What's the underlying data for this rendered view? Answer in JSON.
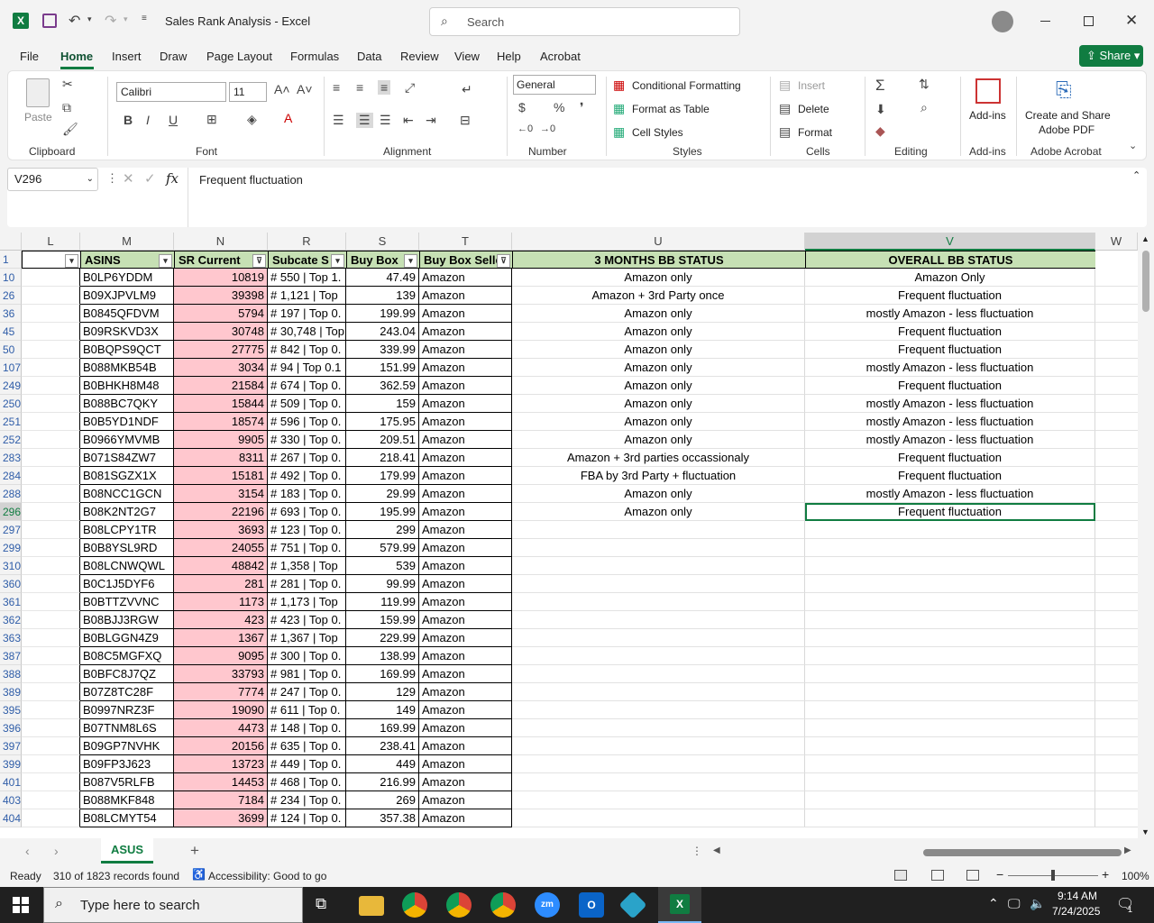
{
  "titlebar": {
    "doc_title": "Sales Rank Analysis",
    "app": "Excel",
    "separator": "-",
    "search_placeholder": "Search"
  },
  "menu": {
    "tabs": [
      "File",
      "Home",
      "Insert",
      "Draw",
      "Page Layout",
      "Formulas",
      "Data",
      "Review",
      "View",
      "Help",
      "Acrobat"
    ],
    "share": "Share"
  },
  "ribbon": {
    "clipboard": {
      "paste": "Paste",
      "label": "Clipboard"
    },
    "font": {
      "name": "Calibri",
      "size": "11",
      "label": "Font"
    },
    "alignment": {
      "label": "Alignment"
    },
    "number": {
      "format": "General",
      "label": "Number",
      "currency": "$",
      "percent": "%"
    },
    "styles": {
      "conditional": "Conditional Formatting",
      "format_table": "Format as Table",
      "cell_styles": "Cell Styles",
      "label": "Styles"
    },
    "cells": {
      "insert": "Insert",
      "delete": "Delete",
      "format": "Format",
      "label": "Cells"
    },
    "editing": {
      "label": "Editing"
    },
    "addins": {
      "btn": "Add-ins",
      "label": "Add-ins"
    },
    "acrobat": {
      "btn1": "Create and Share",
      "btn2": "Adobe PDF",
      "label": "Adobe Acrobat"
    }
  },
  "formula_bar": {
    "name_box": "V296",
    "fx": "fx",
    "value": "Frequent fluctuation"
  },
  "columns": [
    "L",
    "M",
    "N",
    "R",
    "S",
    "T",
    "U",
    "V",
    "W"
  ],
  "headers": {
    "row": "1",
    "M": "ASINS",
    "N": "SR Current",
    "R": "Subcate S",
    "S": "Buy Box",
    "T": "Buy Box Selle",
    "U": "3 MONTHS BB STATUS",
    "V": "OVERALL BB STATUS"
  },
  "rows": [
    {
      "n": "10",
      "m": "B0LP6YDDM",
      "sr": "10819",
      "sub": "# 550 | Top 1.",
      "bb": "47.49",
      "t": "Amazon",
      "u": "Amazon only",
      "v": "Amazon Only"
    },
    {
      "n": "26",
      "m": "B09XJPVLM9",
      "sr": "39398",
      "sub": "# 1,121 | Top",
      "bb": "139",
      "t": "Amazon",
      "u": "Amazon + 3rd Party once",
      "v": "Frequent fluctuation"
    },
    {
      "n": "36",
      "m": "B0845QFDVM",
      "sr": "5794",
      "sub": "# 197 | Top 0.",
      "bb": "199.99",
      "t": "Amazon",
      "u": "Amazon only",
      "v": "mostly Amazon - less fluctuation"
    },
    {
      "n": "45",
      "m": "B09RSKVD3X",
      "sr": "30748",
      "sub": "# 30,748 | Top",
      "bb": "243.04",
      "t": "Amazon",
      "u": "Amazon only",
      "v": "Frequent fluctuation"
    },
    {
      "n": "50",
      "m": "B0BQPS9QCT",
      "sr": "27775",
      "sub": "# 842 | Top 0.",
      "bb": "339.99",
      "t": "Amazon",
      "u": "Amazon only",
      "v": "Frequent fluctuation"
    },
    {
      "n": "107",
      "m": "B088MKB54B",
      "sr": "3034",
      "sub": "# 94 | Top 0.1",
      "bb": "151.99",
      "t": "Amazon",
      "u": "Amazon only",
      "v": "mostly Amazon - less fluctuation"
    },
    {
      "n": "249",
      "m": "B0BHKH8M48",
      "sr": "21584",
      "sub": "# 674 | Top 0.",
      "bb": "362.59",
      "t": "Amazon",
      "u": "Amazon only",
      "v": "Frequent fluctuation"
    },
    {
      "n": "250",
      "m": "B088BC7QKY",
      "sr": "15844",
      "sub": "# 509 | Top 0.",
      "bb": "159",
      "t": "Amazon",
      "u": "Amazon only",
      "v": "mostly Amazon - less fluctuation"
    },
    {
      "n": "251",
      "m": "B0B5YD1NDF",
      "sr": "18574",
      "sub": "# 596 | Top 0.",
      "bb": "175.95",
      "t": "Amazon",
      "u": "Amazon only",
      "v": "mostly Amazon - less fluctuation"
    },
    {
      "n": "252",
      "m": "B0966YMVMB",
      "sr": "9905",
      "sub": "# 330 | Top 0.",
      "bb": "209.51",
      "t": "Amazon",
      "u": "Amazon only",
      "v": "mostly Amazon - less fluctuation"
    },
    {
      "n": "283",
      "m": "B071S84ZW7",
      "sr": "8311",
      "sub": "# 267 | Top 0.",
      "bb": "218.41",
      "t": "Amazon",
      "u": "Amazon + 3rd parties occassionaly",
      "v": "Frequent fluctuation"
    },
    {
      "n": "284",
      "m": "B081SGZX1X",
      "sr": "15181",
      "sub": "# 492 | Top 0.",
      "bb": "179.99",
      "t": "Amazon",
      "u": "FBA by 3rd Party + fluctuation",
      "v": "Frequent fluctuation"
    },
    {
      "n": "288",
      "m": "B08NCC1GCN",
      "sr": "3154",
      "sub": "# 183 | Top 0.",
      "bb": "29.99",
      "t": "Amazon",
      "u": "Amazon only",
      "v": "mostly Amazon - less fluctuation"
    },
    {
      "n": "296",
      "m": "B08K2NT2G7",
      "sr": "22196",
      "sub": "# 693 | Top 0.",
      "bb": "195.99",
      "t": "Amazon",
      "u": "Amazon only",
      "v": "Frequent fluctuation"
    },
    {
      "n": "297",
      "m": "B08LCPY1TR",
      "sr": "3693",
      "sub": "# 123 | Top 0.",
      "bb": "299",
      "t": "Amazon",
      "u": "",
      "v": ""
    },
    {
      "n": "299",
      "m": "B0B8YSL9RD",
      "sr": "24055",
      "sub": "# 751 | Top 0.",
      "bb": "579.99",
      "t": "Amazon",
      "u": "",
      "v": ""
    },
    {
      "n": "310",
      "m": "B08LCNWQWL",
      "sr": "48842",
      "sub": "# 1,358 | Top",
      "bb": "539",
      "t": "Amazon",
      "u": "",
      "v": ""
    },
    {
      "n": "360",
      "m": "B0C1J5DYF6",
      "sr": "281",
      "sub": "# 281 | Top 0.",
      "bb": "99.99",
      "t": "Amazon",
      "u": "",
      "v": ""
    },
    {
      "n": "361",
      "m": "B0BTTZVVNC",
      "sr": "1173",
      "sub": "# 1,173 | Top",
      "bb": "119.99",
      "t": "Amazon",
      "u": "",
      "v": ""
    },
    {
      "n": "362",
      "m": "B08BJJ3RGW",
      "sr": "423",
      "sub": "# 423 | Top 0.",
      "bb": "159.99",
      "t": "Amazon",
      "u": "",
      "v": ""
    },
    {
      "n": "363",
      "m": "B0BLGGN4Z9",
      "sr": "1367",
      "sub": "# 1,367 | Top",
      "bb": "229.99",
      "t": "Amazon",
      "u": "",
      "v": ""
    },
    {
      "n": "387",
      "m": "B08C5MGFXQ",
      "sr": "9095",
      "sub": "# 300 | Top 0.",
      "bb": "138.99",
      "t": "Amazon",
      "u": "",
      "v": ""
    },
    {
      "n": "388",
      "m": "B0BFC8J7QZ",
      "sr": "33793",
      "sub": "# 981 | Top 0.",
      "bb": "169.99",
      "t": "Amazon",
      "u": "",
      "v": ""
    },
    {
      "n": "389",
      "m": "B07Z8TC28F",
      "sr": "7774",
      "sub": "# 247 | Top 0.",
      "bb": "129",
      "t": "Amazon",
      "u": "",
      "v": ""
    },
    {
      "n": "395",
      "m": "B0997NRZ3F",
      "sr": "19090",
      "sub": "# 611 | Top 0.",
      "bb": "149",
      "t": "Amazon",
      "u": "",
      "v": ""
    },
    {
      "n": "396",
      "m": "B07TNM8L6S",
      "sr": "4473",
      "sub": "# 148 | Top 0.",
      "bb": "169.99",
      "t": "Amazon",
      "u": "",
      "v": ""
    },
    {
      "n": "397",
      "m": "B09GP7NVHK",
      "sr": "20156",
      "sub": "# 635 | Top 0.",
      "bb": "238.41",
      "t": "Amazon",
      "u": "",
      "v": ""
    },
    {
      "n": "399",
      "m": "B09FP3J623",
      "sr": "13723",
      "sub": "# 449 | Top 0.",
      "bb": "449",
      "t": "Amazon",
      "u": "",
      "v": ""
    },
    {
      "n": "401",
      "m": "B087V5RLFB",
      "sr": "14453",
      "sub": "# 468 | Top 0.",
      "bb": "216.99",
      "t": "Amazon",
      "u": "",
      "v": ""
    },
    {
      "n": "403",
      "m": "B088MKF848",
      "sr": "7184",
      "sub": "# 234 | Top 0.",
      "bb": "269",
      "t": "Amazon",
      "u": "",
      "v": ""
    },
    {
      "n": "404",
      "m": "B08LCMYT54",
      "sr": "3699",
      "sub": "# 124 | Top 0.",
      "bb": "357.38",
      "t": "Amazon",
      "u": "",
      "v": ""
    }
  ],
  "sheet": {
    "tab": "ASUS",
    "add": "+"
  },
  "status": {
    "ready": "Ready",
    "records": "310 of 1823 records found",
    "accessibility": "Accessibility: Good to go",
    "zoom": "100%"
  },
  "taskbar": {
    "search_placeholder": "Type here to search",
    "time": "9:14 AM",
    "date": "7/24/2025",
    "notif": "1"
  },
  "colors": {
    "excel_green": "#107c41",
    "header_green": "#c6e0b4",
    "pink": "#ffc7ce"
  }
}
